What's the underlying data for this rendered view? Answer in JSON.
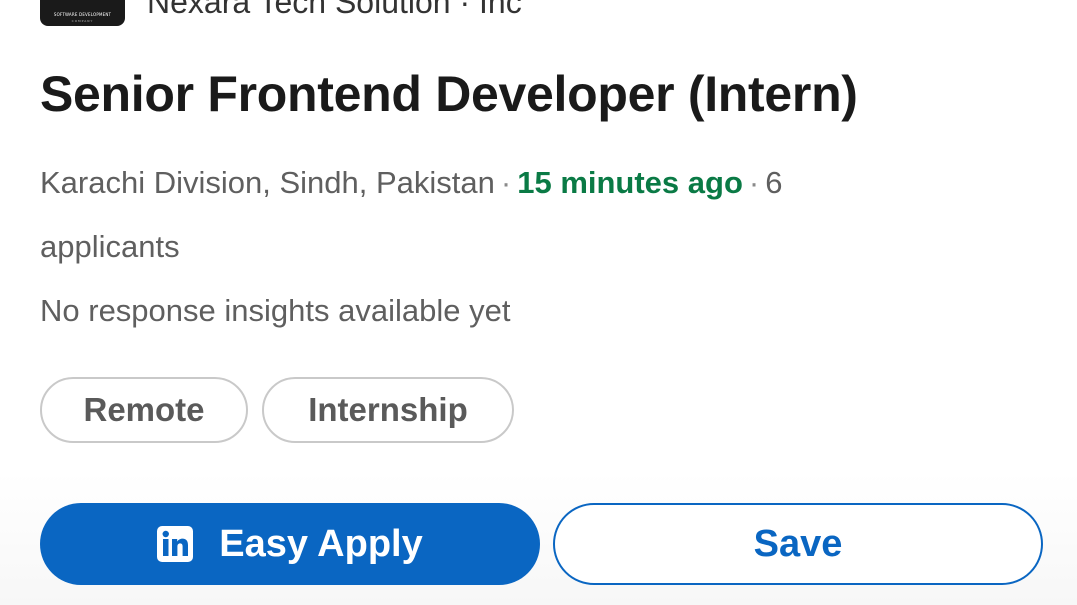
{
  "company": {
    "logo_text": "SOFTWARE DEVELOPMENT",
    "logo_subtext": "COMPANY",
    "name": "Nexara Tech Solution · Inc"
  },
  "job": {
    "title": "Senior Frontend Developer (Intern)",
    "location": "Karachi Division, Sindh, Pakistan",
    "separator": "·",
    "posted": "15 minutes ago",
    "applicants_count": "6",
    "applicants_label": "applicants",
    "insights": "No response insights available yet"
  },
  "chips": {
    "remote": "Remote",
    "internship": "Internship"
  },
  "actions": {
    "apply_label": "Easy Apply",
    "save_label": "Save"
  },
  "colors": {
    "brand_blue": "#0a66c2",
    "posted_green": "#0a7a45"
  }
}
